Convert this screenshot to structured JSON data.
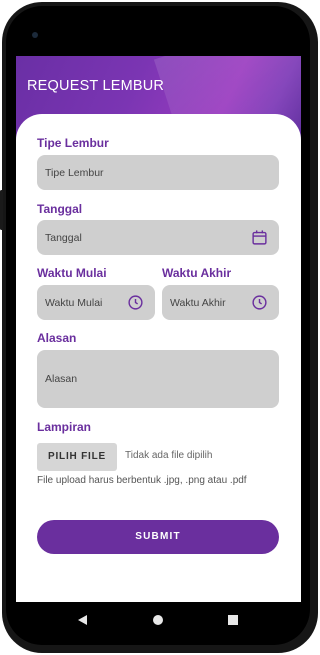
{
  "header": {
    "title": "REQUEST LEMBUR"
  },
  "form": {
    "tipe_lembur": {
      "label": "Tipe Lembur",
      "placeholder": "Tipe Lembur"
    },
    "tanggal": {
      "label": "Tanggal",
      "placeholder": "Tanggal",
      "icon": "calendar-icon"
    },
    "waktu_mulai": {
      "label": "Waktu Mulai",
      "placeholder": "Waktu Mulai",
      "icon": "clock-icon"
    },
    "waktu_akhir": {
      "label": "Waktu Akhir",
      "placeholder": "Waktu Akhir",
      "icon": "clock-icon"
    },
    "alasan": {
      "label": "Alasan",
      "placeholder": "Alasan"
    },
    "lampiran": {
      "label": "Lampiran",
      "button": "PILIH FILE",
      "status": "Tidak ada file dipilih",
      "hint": "File upload harus berbentuk .jpg, .png atau .pdf"
    },
    "submit": "SUBMIT"
  },
  "colors": {
    "accent": "#6a2f9e",
    "field_bg": "#cfcfcf"
  },
  "navbar": {
    "icons": [
      "back-icon",
      "home-icon",
      "recents-icon"
    ]
  }
}
